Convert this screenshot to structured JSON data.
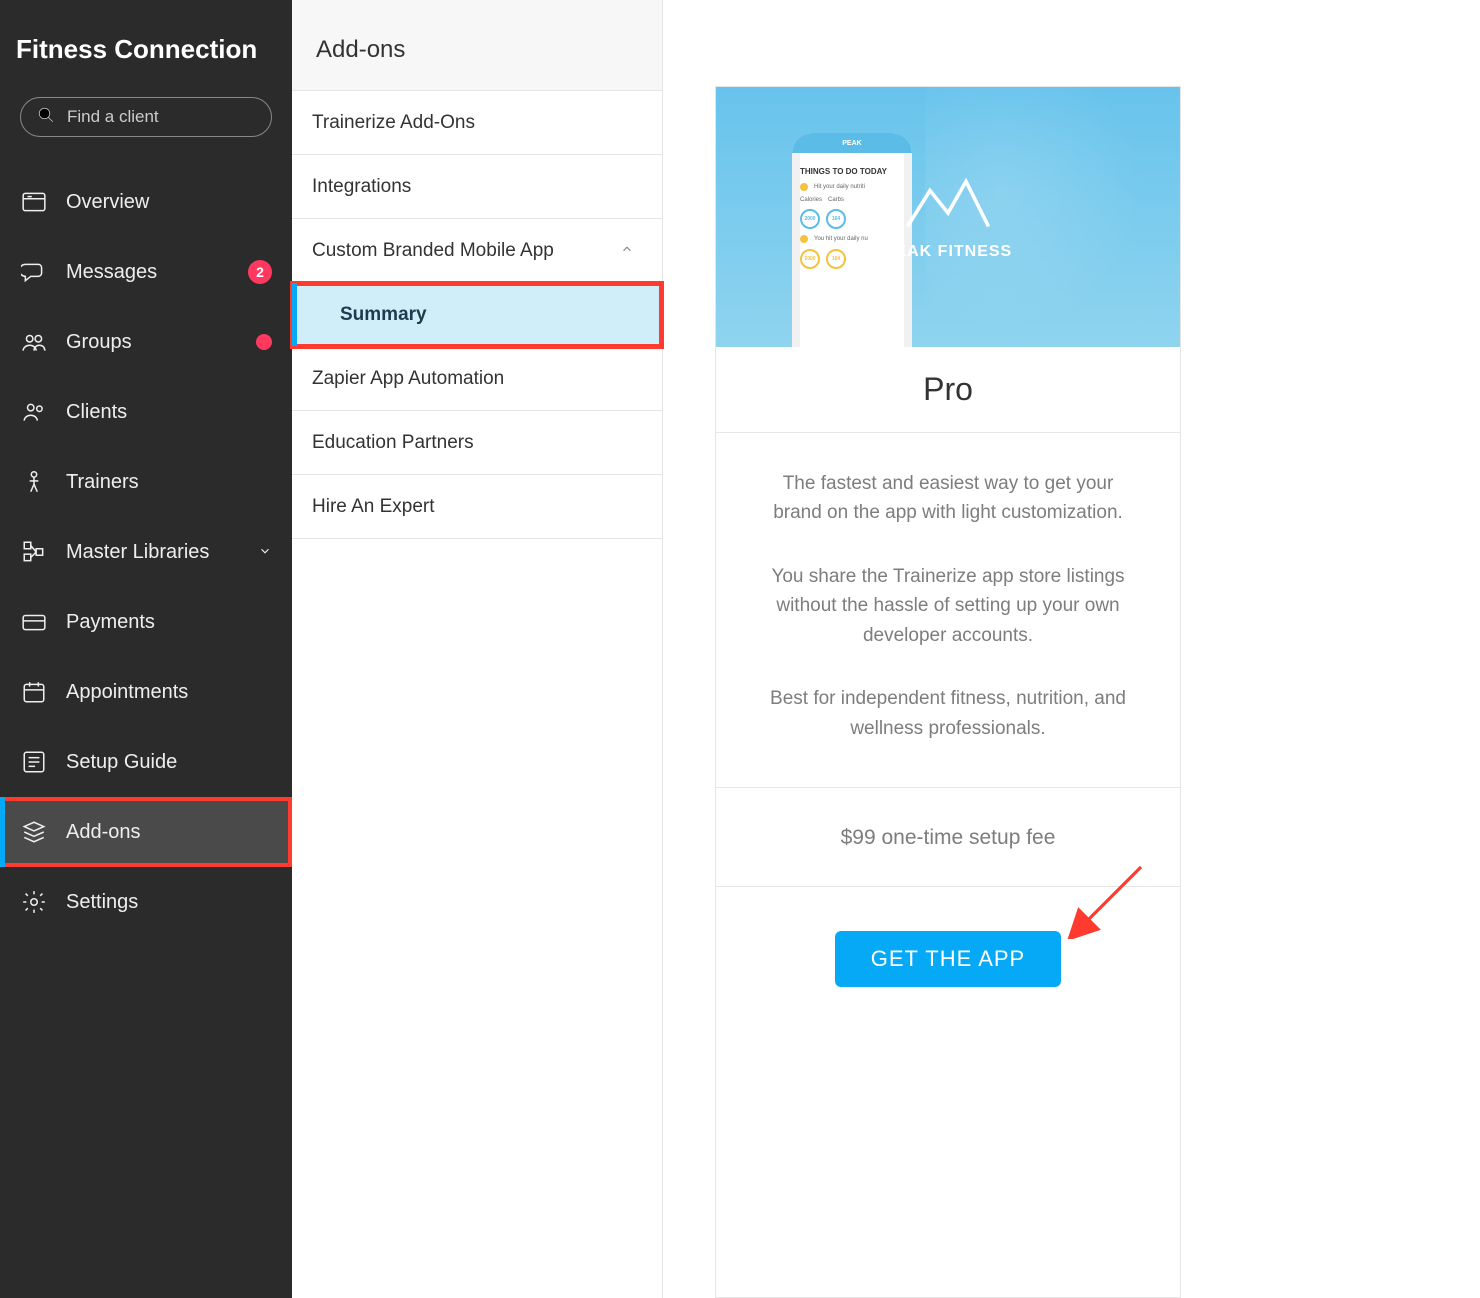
{
  "brand": "Fitness Connection",
  "search": {
    "placeholder": "Find a client"
  },
  "nav": [
    {
      "label": "Overview",
      "icon": "overview"
    },
    {
      "label": "Messages",
      "icon": "messages",
      "badge": "2"
    },
    {
      "label": "Groups",
      "icon": "groups",
      "dot": true
    },
    {
      "label": "Clients",
      "icon": "clients"
    },
    {
      "label": "Trainers",
      "icon": "trainers"
    },
    {
      "label": "Master Libraries",
      "icon": "libraries",
      "chevron": true
    },
    {
      "label": "Payments",
      "icon": "payments"
    },
    {
      "label": "Appointments",
      "icon": "appointments"
    },
    {
      "label": "Setup Guide",
      "icon": "guide"
    },
    {
      "label": "Add-ons",
      "icon": "addons",
      "active": true,
      "highlight": true
    },
    {
      "label": "Settings",
      "icon": "settings"
    }
  ],
  "subnav": {
    "header": "Add-ons",
    "items": [
      {
        "label": "Trainerize Add-Ons"
      },
      {
        "label": "Integrations"
      },
      {
        "label": "Custom Branded Mobile App",
        "expanded": true,
        "sub": {
          "label": "Summary",
          "active": true,
          "highlight": true
        }
      },
      {
        "label": "Zapier App Automation"
      },
      {
        "label": "Education Partners"
      },
      {
        "label": "Hire An Expert"
      }
    ]
  },
  "plan": {
    "logo_text": "PEAK FITNESS",
    "phone_header": "PEAK",
    "phone_section1": "THINGS TO DO TODAY",
    "phone_line1": "Hit your daily nutriti",
    "phone_metric1a": "2000",
    "phone_metric1b": "164",
    "phone_label1a": "Calories",
    "phone_label1b": "Carbs",
    "phone_line2": "You hit your daily nu",
    "phone_metric2a": "2000",
    "phone_metric2b": "164",
    "title": "Pro",
    "desc1": "The fastest and easiest way to get your brand on the app with light customization.",
    "desc2": "You share the Trainerize app store listings without the hassle of setting up your own developer accounts.",
    "desc3": "Best for independent fitness, nutrition, and wellness professionals.",
    "fee": "$99 one-time setup fee",
    "cta": "GET THE APP"
  }
}
